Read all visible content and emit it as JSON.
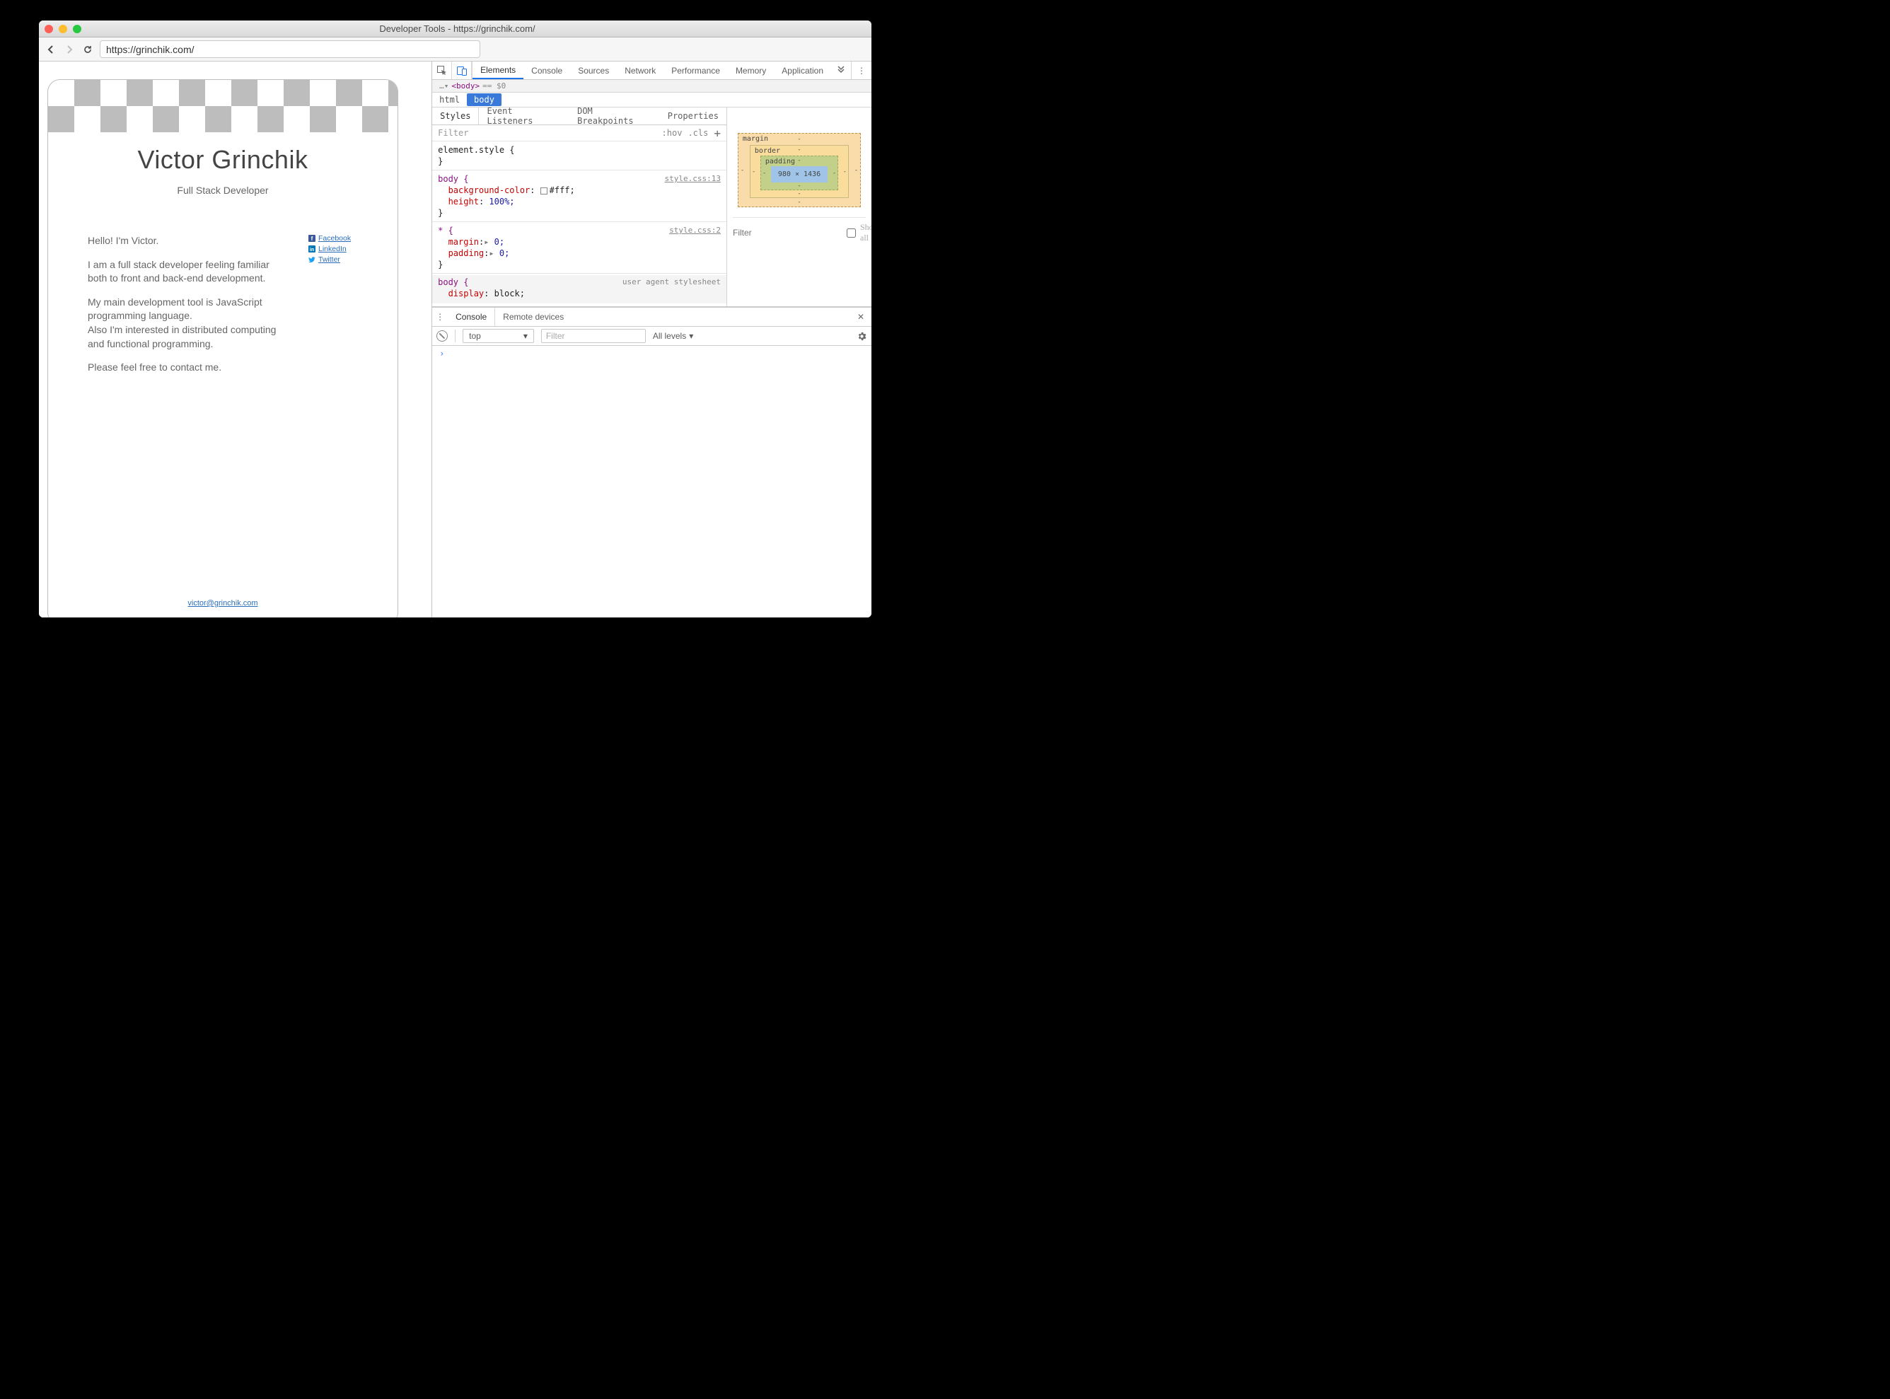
{
  "window": {
    "title": "Developer Tools - https://grinchik.com/"
  },
  "toolbar": {
    "url": "https://grinchik.com/"
  },
  "page": {
    "name": "Victor Grinchik",
    "subtitle": "Full Stack Developer",
    "paragraphs": {
      "p1": "Hello! I'm Victor.",
      "p2": "I am a full stack developer feeling familiar both to front and back-end development.",
      "p3": "My main development tool is JavaScript programming language.",
      "p4": "Also I'm interested in distributed computing and functional programming.",
      "p5": "Please feel free to contact me."
    },
    "social": {
      "facebook": "Facebook",
      "linkedin": "LinkedIn",
      "twitter": "Twitter"
    },
    "email": "victor@grinchik.com"
  },
  "devtools": {
    "tabs": {
      "elements": "Elements",
      "console": "Console",
      "sources": "Sources",
      "network": "Network",
      "performance": "Performance",
      "memory": "Memory",
      "application": "Application"
    },
    "dom_line": {
      "prefix": "…▾",
      "tag": "<body>",
      "suffix": " == $0"
    },
    "breadcrumb": {
      "root": "html",
      "current": "body"
    },
    "subtabs": {
      "styles": "Styles",
      "listeners": "Event Listeners",
      "dom": "DOM Breakpoints",
      "props": "Properties"
    },
    "filter": {
      "placeholder": "Filter",
      "hov": ":hov",
      "cls": ".cls"
    },
    "rules": {
      "elementStyle": "element.style {",
      "body_sel": "body {",
      "body_src": "style.css:13",
      "bg_k": "background-color",
      "bg_v": "#fff;",
      "h_k": "height",
      "h_v": "100%;",
      "star_sel": "* {",
      "star_src": "style.css:2",
      "m_k": "margin",
      "m_v": "0;",
      "p_k": "padding",
      "p_v": "0;",
      "ua_sel": "body {",
      "ua_src": "user agent stylesheet",
      "d_k": "display",
      "d_v": "block;",
      "brace": "}"
    },
    "boxmodel": {
      "margin": "margin",
      "border": "border",
      "padding": "padding",
      "dims": "980 × 1436",
      "dash": "-"
    },
    "computed": {
      "filter_placeholder": "Filter",
      "showall": "Show all"
    },
    "drawer": {
      "tabs": {
        "console": "Console",
        "remote": "Remote devices"
      },
      "context": "top",
      "filter_placeholder": "Filter",
      "levels": "All levels",
      "prompt": "›"
    }
  }
}
